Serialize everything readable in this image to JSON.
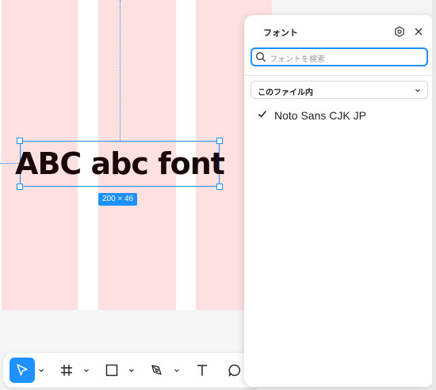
{
  "canvas": {
    "text_content": "ABC abc font",
    "size_badge": "200 × 46",
    "colors": {
      "column_fill": "#ffe0e0",
      "selection": "#1e90ff",
      "text": "#1a0808"
    }
  },
  "toolbar": {
    "tools": [
      {
        "name": "move-tool",
        "icon": "cursor-arrow-icon",
        "active": true
      },
      {
        "name": "frame-tool",
        "icon": "hash-frame-icon",
        "active": false
      },
      {
        "name": "shape-tool",
        "icon": "rectangle-icon",
        "active": false
      },
      {
        "name": "pen-tool",
        "icon": "pen-icon",
        "active": false
      },
      {
        "name": "text-tool",
        "icon": "text-t-icon",
        "active": false
      },
      {
        "name": "comment-tool",
        "icon": "comment-bubble-icon",
        "active": false
      }
    ]
  },
  "font_panel": {
    "title": "フォント",
    "search_placeholder": "フォントを検索",
    "filter_selected": "このファイル内",
    "fonts": [
      {
        "name": "Noto Sans CJK JP",
        "selected": true
      }
    ]
  }
}
